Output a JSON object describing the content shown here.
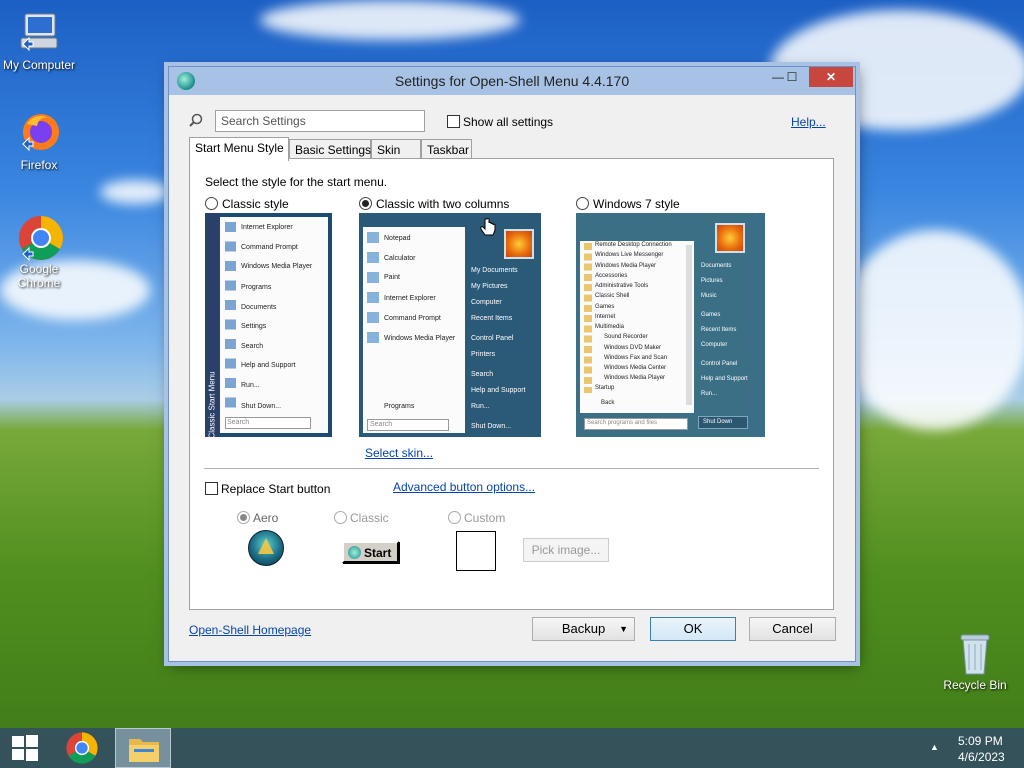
{
  "desktop": {
    "icons": [
      {
        "label": "My Computer"
      },
      {
        "label": "Firefox"
      },
      {
        "label": "Google Chrome"
      },
      {
        "label": "Recycle Bin"
      }
    ]
  },
  "window": {
    "title": "Settings for Open-Shell Menu 4.4.170",
    "minimize": "—",
    "maximize": "☐",
    "close": "✕"
  },
  "toolbar": {
    "search_placeholder": "Search Settings",
    "show_all_label": "Show all settings",
    "help_link": "Help..."
  },
  "tabs": [
    {
      "label": "Start Menu Style",
      "active": true
    },
    {
      "label": "Basic Settings"
    },
    {
      "label": "Skin"
    },
    {
      "label": "Taskbar"
    }
  ],
  "panel": {
    "instruction": "Select the style for the start menu.",
    "styles": [
      {
        "label": "Classic style",
        "selected": false
      },
      {
        "label": "Classic with two columns",
        "selected": true
      },
      {
        "label": "Windows 7 style",
        "selected": false
      }
    ],
    "select_skin_link": "Select skin...",
    "replace_start_label": "Replace Start button",
    "advanced_button_link": "Advanced button options...",
    "button_styles": [
      {
        "label": "Aero",
        "selected": true
      },
      {
        "label": "Classic",
        "selected": false
      },
      {
        "label": "Custom",
        "selected": false
      }
    ],
    "classic_button_text": "Start",
    "pick_image_label": "Pick image..."
  },
  "previews": {
    "classic": {
      "items": [
        "Internet Explorer",
        "Command Prompt",
        "Windows Media Player",
        "Programs",
        "Documents",
        "Settings",
        "Search",
        "Help and Support",
        "Run...",
        "Shut Down..."
      ],
      "side_label": "Classic Start Menu",
      "search": "Search"
    },
    "two_columns": {
      "left_items": [
        "Notepad",
        "Calculator",
        "Paint",
        "Internet Explorer",
        "Command Prompt",
        "Windows Media Player"
      ],
      "programs": "Programs",
      "right_items": [
        "My Documents",
        "My Pictures",
        "Computer",
        "Recent Items",
        "Control Panel",
        "Printers",
        "Search",
        "Help and Support",
        "Run...",
        "Shut Down..."
      ],
      "search": "Search"
    },
    "win7": {
      "left_items": [
        "Remote Desktop Connection",
        "Windows Live Messenger",
        "Windows Media Player",
        "Accessories",
        "Administrative Tools",
        "Classic Shell",
        "Games",
        "Internet",
        "Multimedia",
        "Sound Recorder",
        "Windows DVD Maker",
        "Windows Fax and Scan",
        "Windows Media Center",
        "Windows Media Player",
        "Startup",
        "Back"
      ],
      "right_items": [
        "Documents",
        "Pictures",
        "Music",
        "Games",
        "Recent Items",
        "Computer",
        "Control Panel",
        "Help and Support",
        "Run..."
      ],
      "search": "Search programs and files",
      "shutdown": "Shut Down"
    }
  },
  "footer": {
    "homepage_link": "Open-Shell Homepage",
    "backup_label": "Backup",
    "ok_label": "OK",
    "cancel_label": "Cancel"
  },
  "taskbar": {
    "time": "5:09 PM",
    "date": "4/6/2023",
    "tray_arrow": "▲"
  }
}
